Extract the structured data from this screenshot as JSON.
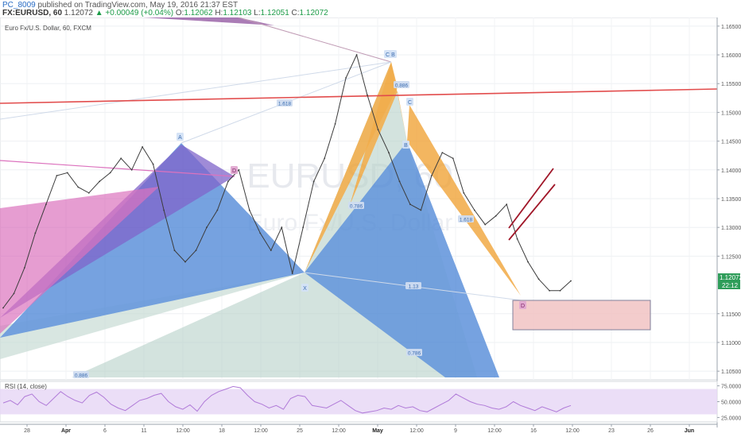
{
  "header": {
    "author": "PC_8009",
    "published": "published on TradingView.com, May 19, 2016 21:37 EST",
    "symbol": "FX:EURUSD, 60",
    "last": "1.12072",
    "change": "+0.00049 (+0.04%)",
    "o_label": "O:",
    "o_value": "1.12062",
    "h_label": "H:",
    "h_value": "1.12103",
    "l_label": "L:",
    "l_value": "1.12051",
    "c_label": "C:",
    "c_value": "1.12072"
  },
  "chart_title": "Euro Fx/U.S. Dollar, 60, FXCM",
  "watermark": "EURUSD, 60",
  "watermark_sub": "Euro Fx/U.S. Dollar",
  "last_price_tag": "1.12072",
  "countdown_tag": "22:12",
  "colors": {
    "blue_pattern": "#4c86d6",
    "light_pattern": "#b8d4cc",
    "orange_pattern": "#f0a030",
    "pink_pattern": "#d65bb3",
    "purple_pattern": "#6a4ac0",
    "red_line": "#e24c4c",
    "channel": "#a01628",
    "box_fill": "#f2c4c4",
    "box_stroke": "#6a6a8a",
    "rsi_line": "#b07ad8",
    "rsi_band": "#e6d6f5"
  },
  "chart_data": {
    "type": "line",
    "title": "Euro Fx/U.S. Dollar, 60, FXCM",
    "price_axis_ticks": [
      "1.16500",
      "1.16000",
      "1.15500",
      "1.15000",
      "1.14500",
      "1.14000",
      "1.13500",
      "1.13000",
      "1.12500",
      "1.11500",
      "1.11000",
      "1.10500"
    ],
    "ylim": [
      1.1035,
      1.1665
    ],
    "date_axis_ticks": [
      "28",
      "Apr",
      "6",
      "11",
      "12:00",
      "18",
      "12:00",
      "25",
      "12:00",
      "May",
      "12:00",
      "9",
      "12:00",
      "16",
      "12:00",
      "23",
      "26",
      "Jun"
    ],
    "pattern_points": [
      "A",
      "D",
      "X",
      "C",
      "B",
      "C",
      "B",
      "D"
    ],
    "fib_ratios": [
      "1.618",
      "0.886",
      "0.786",
      "1.13",
      "0.786",
      "1.618",
      "0.886"
    ],
    "price_points": [
      1.116,
      1.1185,
      1.123,
      1.129,
      1.134,
      1.139,
      1.1395,
      1.137,
      1.136,
      1.138,
      1.1395,
      1.142,
      1.14,
      1.144,
      1.141,
      1.133,
      1.126,
      1.124,
      1.126,
      1.13,
      1.133,
      1.138,
      1.14,
      1.133,
      1.129,
      1.126,
      1.13,
      1.122,
      1.13,
      1.138,
      1.142,
      1.148,
      1.156,
      1.16,
      1.153,
      1.147,
      1.143,
      1.138,
      1.134,
      1.133,
      1.139,
      1.143,
      1.142,
      1.136,
      1.133,
      1.1305,
      1.132,
      1.134,
      1.128,
      1.124,
      1.121,
      1.119,
      1.119,
      1.1207
    ],
    "rsi": {
      "label": "RSI (14, close)",
      "ticks": [
        "75.0000",
        "50.0000",
        "25.0000"
      ],
      "ylim": [
        18,
        82
      ],
      "band": [
        30,
        70
      ],
      "values": [
        48,
        52,
        45,
        58,
        62,
        50,
        44,
        55,
        66,
        58,
        52,
        48,
        60,
        65,
        57,
        46,
        40,
        36,
        44,
        52,
        55,
        60,
        63,
        50,
        42,
        38,
        45,
        35,
        50,
        60,
        66,
        70,
        74,
        72,
        60,
        50,
        46,
        40,
        44,
        38,
        55,
        60,
        58,
        44,
        42,
        40,
        46,
        52,
        44,
        36,
        32,
        34,
        36,
        40,
        38,
        44,
        40,
        42,
        36,
        34,
        40,
        46,
        52,
        62,
        56,
        50,
        46,
        44,
        40,
        38,
        42,
        50,
        44,
        40,
        36,
        42,
        38,
        34,
        40,
        44
      ]
    }
  }
}
